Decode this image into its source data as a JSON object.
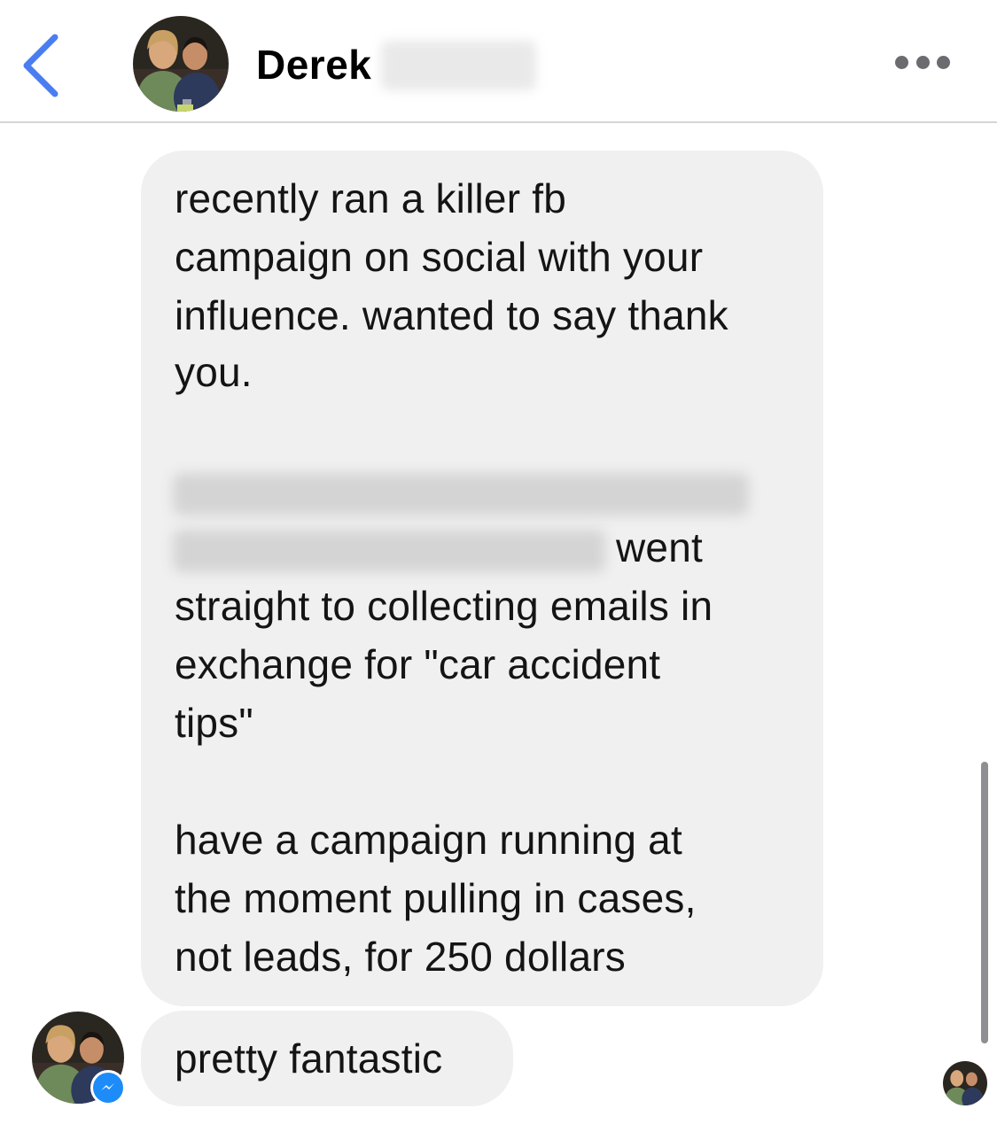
{
  "header": {
    "back_icon": "chevron-left-icon",
    "contact_first_name": "Derek",
    "contact_surname_redacted": true,
    "more_icon": "ellipsis-icon",
    "accent_color": "#4a7ef0"
  },
  "messages": [
    {
      "sender": "Derek",
      "lines": [
        "recently ran a killer fb",
        "campaign on social with your",
        "influence. wanted to say thank",
        "you.",
        "",
        "went",
        "straight to collecting emails in",
        "exchange for \"car accident",
        "tips\"",
        "",
        "have a campaign running at",
        "the moment pulling in cases,",
        "not leads, for 250 dollars"
      ],
      "redacted_segments": 2
    },
    {
      "sender": "Derek",
      "text": "pretty fantastic"
    }
  ],
  "status": {
    "badge_icon": "messenger-icon",
    "badge_color": "#1d8cf8",
    "read_receipt": "read-receipt-avatar"
  }
}
